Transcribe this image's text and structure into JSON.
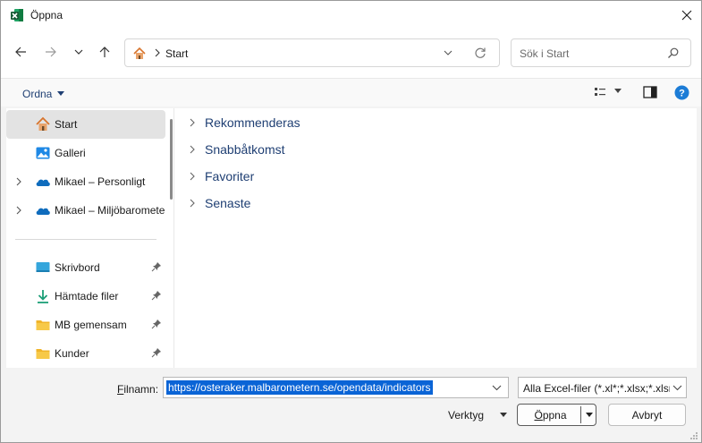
{
  "window": {
    "title": "Öppna",
    "app_icon": "excel-icon"
  },
  "navigation": {
    "back_icon": "arrow-left-icon",
    "forward_icon": "arrow-right-icon",
    "recent_icon": "chevron-down-icon",
    "up_icon": "arrow-up-icon",
    "address": {
      "home_icon": "home-icon",
      "crumb": "Start"
    },
    "search": {
      "placeholder": "Sök i Start"
    }
  },
  "toolbar": {
    "organize_label": "Ordna",
    "view_icon": "view-options-icon",
    "preview_icon": "preview-pane-icon",
    "help_icon": "help-icon"
  },
  "sidebar": {
    "items": [
      {
        "label": "Start",
        "icon": "home-icon",
        "selected": true
      },
      {
        "label": "Galleri",
        "icon": "gallery-icon"
      },
      {
        "label": "Mikael – Personligt",
        "icon": "onedrive-icon",
        "expandable": true
      },
      {
        "label": "Mikael – Miljöbarometern",
        "icon": "onedrive-icon",
        "expandable": true
      },
      {
        "label": "Skrivbord",
        "icon": "desktop-icon",
        "pinned": true
      },
      {
        "label": "Hämtade filer",
        "icon": "download-icon",
        "pinned": true
      },
      {
        "label": "MB gemensam",
        "icon": "folder-icon",
        "pinned": true
      },
      {
        "label": "Kunder",
        "icon": "folder-icon",
        "pinned": true
      }
    ]
  },
  "main": {
    "groups": [
      {
        "label": "Rekommenderas"
      },
      {
        "label": "Snabbåtkomst"
      },
      {
        "label": "Favoriter"
      },
      {
        "label": "Senaste"
      }
    ]
  },
  "footer": {
    "filename_label_accel": "F",
    "filename_label_rest": "ilnamn:",
    "filename_value": "https://osteraker.malbarometern.se/opendata/indicators",
    "filter_value": "Alla Excel-filer (*.xl*;*.xlsx;*.xlsm;",
    "tools_label": "Verktyg",
    "open_label_accel": "Ö",
    "open_label_rest": "ppna",
    "cancel_label": "Avbryt"
  },
  "colors": {
    "accent": "#0a64d6",
    "link_text": "#1f3f73",
    "excel_green": "#1d6f42",
    "folder_yellow": "#f7c948",
    "onedrive_blue": "#0f6cbd"
  }
}
